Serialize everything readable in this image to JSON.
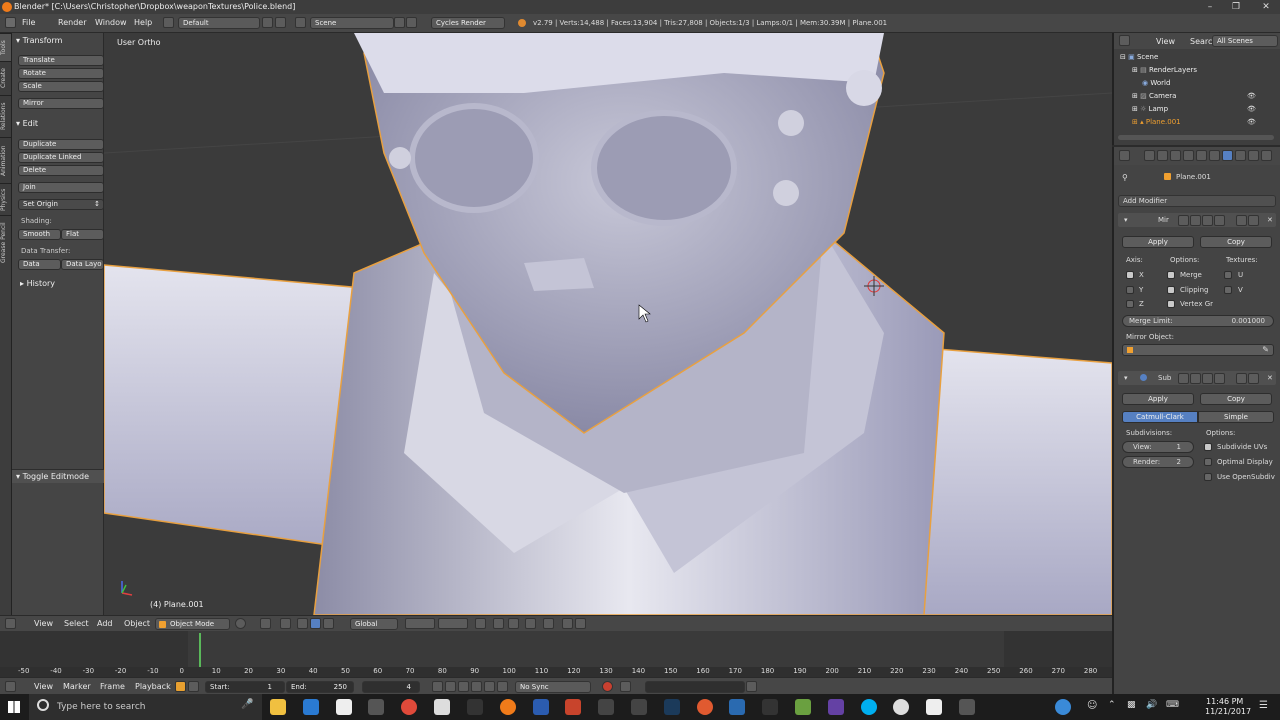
{
  "window": {
    "title": "Blender* [C:\\Users\\Christopher\\Dropbox\\weaponTextures\\Police.blend]"
  },
  "menubar": {
    "items": [
      "File",
      "Render",
      "Window",
      "Help"
    ],
    "layout": "Default",
    "scene": "Scene",
    "engine": "Cycles Render",
    "stats": "v2.79 | Verts:14,488 | Faces:13,904 | Tris:27,808 | Objects:1/3 | Lamps:0/1 | Mem:30.39M | Plane.001"
  },
  "left_tabs": [
    "Tools",
    "Create",
    "Relations",
    "Animation",
    "Physics",
    "Grease Pencil"
  ],
  "toolshelf": {
    "transform_header": "Transform",
    "transform_buttons": [
      "Translate",
      "Rotate",
      "Scale"
    ],
    "mirror": "Mirror",
    "edit_header": "Edit",
    "edit_buttons": [
      "Duplicate",
      "Duplicate Linked",
      "Delete"
    ],
    "join": "Join",
    "set_origin": "Set Origin",
    "shading_label": "Shading:",
    "smooth": "Smooth",
    "flat": "Flat",
    "data_transfer_label": "Data Transfer:",
    "data": "Data",
    "data_layout": "Data Layo",
    "history": "History",
    "toggle_editmode": "Toggle Editmode"
  },
  "viewport": {
    "view_label": "User Ortho",
    "object_label": "(4) Plane.001"
  },
  "viewport_header": {
    "items": [
      "View",
      "Select",
      "Add",
      "Object"
    ],
    "mode": "Object Mode",
    "orientation": "Global"
  },
  "timeline": {
    "ticks": [
      "-50",
      "-40",
      "-30",
      "-20",
      "-10",
      "0",
      "10",
      "20",
      "30",
      "40",
      "50",
      "60",
      "70",
      "80",
      "90",
      "100",
      "110",
      "120",
      "130",
      "140",
      "150",
      "160",
      "170",
      "180",
      "190",
      "200",
      "210",
      "220",
      "230",
      "240",
      "250",
      "260",
      "270",
      "280"
    ],
    "menu": [
      "View",
      "Marker",
      "Frame",
      "Playback"
    ],
    "start_label": "Start:",
    "start": "1",
    "end_label": "End:",
    "end": "250",
    "current": "4",
    "sync": "No Sync"
  },
  "outliner": {
    "tabs": [
      "View",
      "Search",
      "All Scenes"
    ],
    "items": [
      "Scene",
      "RenderLayers",
      "World",
      "Camera",
      "Lamp",
      "Plane.001"
    ]
  },
  "properties": {
    "object_name": "Plane.001",
    "add_modifier": "Add Modifier",
    "mirror": {
      "name": "Mir",
      "apply": "Apply",
      "copy": "Copy",
      "axis_label": "Axis:",
      "options_label": "Options:",
      "textures_label": "Textures:",
      "axes": [
        "X",
        "Y",
        "Z"
      ],
      "options": [
        "Merge",
        "Clipping",
        "Vertex Gr"
      ],
      "textures": [
        "U",
        "V"
      ],
      "merge_limit_label": "Merge Limit:",
      "merge_limit": "0.001000",
      "mirror_object_label": "Mirror Object:"
    },
    "subsurf": {
      "name": "Sub",
      "apply": "Apply",
      "copy": "Copy",
      "catmull": "Catmull-Clark",
      "simple": "Simple",
      "subdivisions_label": "Subdivisions:",
      "options_label": "Options:",
      "view_label": "View:",
      "view": "1",
      "render_label": "Render:",
      "render": "2",
      "options": [
        "Subdivide UVs",
        "Optimal Display",
        "Use OpenSubdiv"
      ]
    }
  },
  "taskbar": {
    "search_placeholder": "Type here to search",
    "time": "11:46 PM",
    "date": "11/21/2017"
  },
  "colors": {
    "accent": "#5680c2",
    "selected_orange": "#f0a030",
    "viewport_bg": "#3b3b3b"
  }
}
